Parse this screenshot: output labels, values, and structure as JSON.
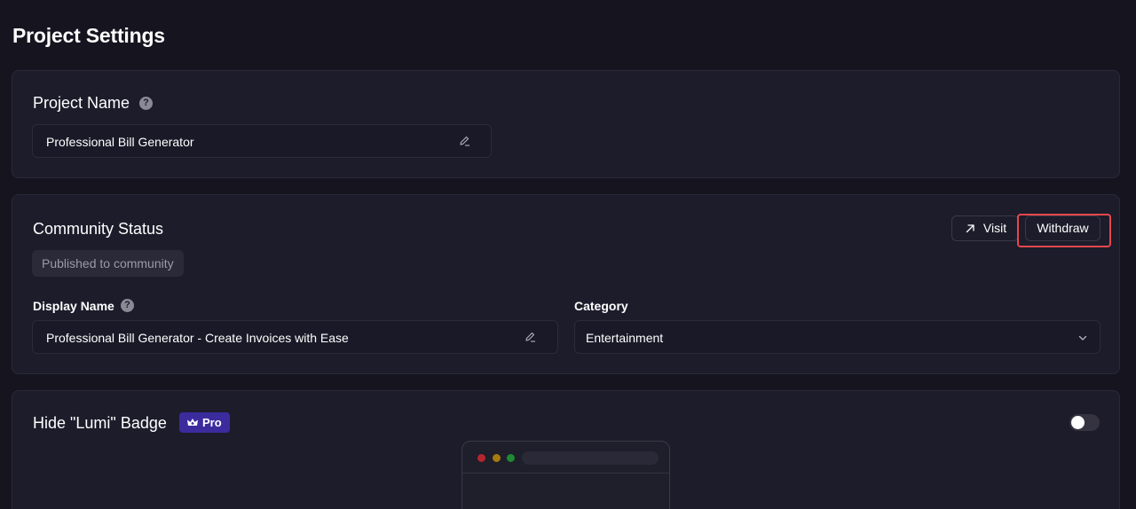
{
  "page": {
    "title": "Project Settings"
  },
  "project_name": {
    "title": "Project Name",
    "help_icon": "?",
    "value": "Professional Bill Generator"
  },
  "community_status": {
    "title": "Community Status",
    "status": "Published to community",
    "visit_label": "Visit",
    "withdraw_label": "Withdraw",
    "display_name": {
      "label": "Display Name",
      "help_icon": "?",
      "value": "Professional Bill Generator - Create Invoices with Ease"
    },
    "category": {
      "label": "Category",
      "selected": "Entertainment"
    }
  },
  "hide_badge": {
    "title": "Hide \"Lumi\" Badge",
    "pro_label": "Pro",
    "toggle_on": false
  },
  "colors": {
    "background": "#15141f",
    "card": "#1d1c2b",
    "highlight": "#e5484d",
    "pro_badge": "#3b2c9e",
    "dot_red": "#b3262e",
    "dot_yellow": "#a77a0e",
    "dot_green": "#1e8a31"
  }
}
